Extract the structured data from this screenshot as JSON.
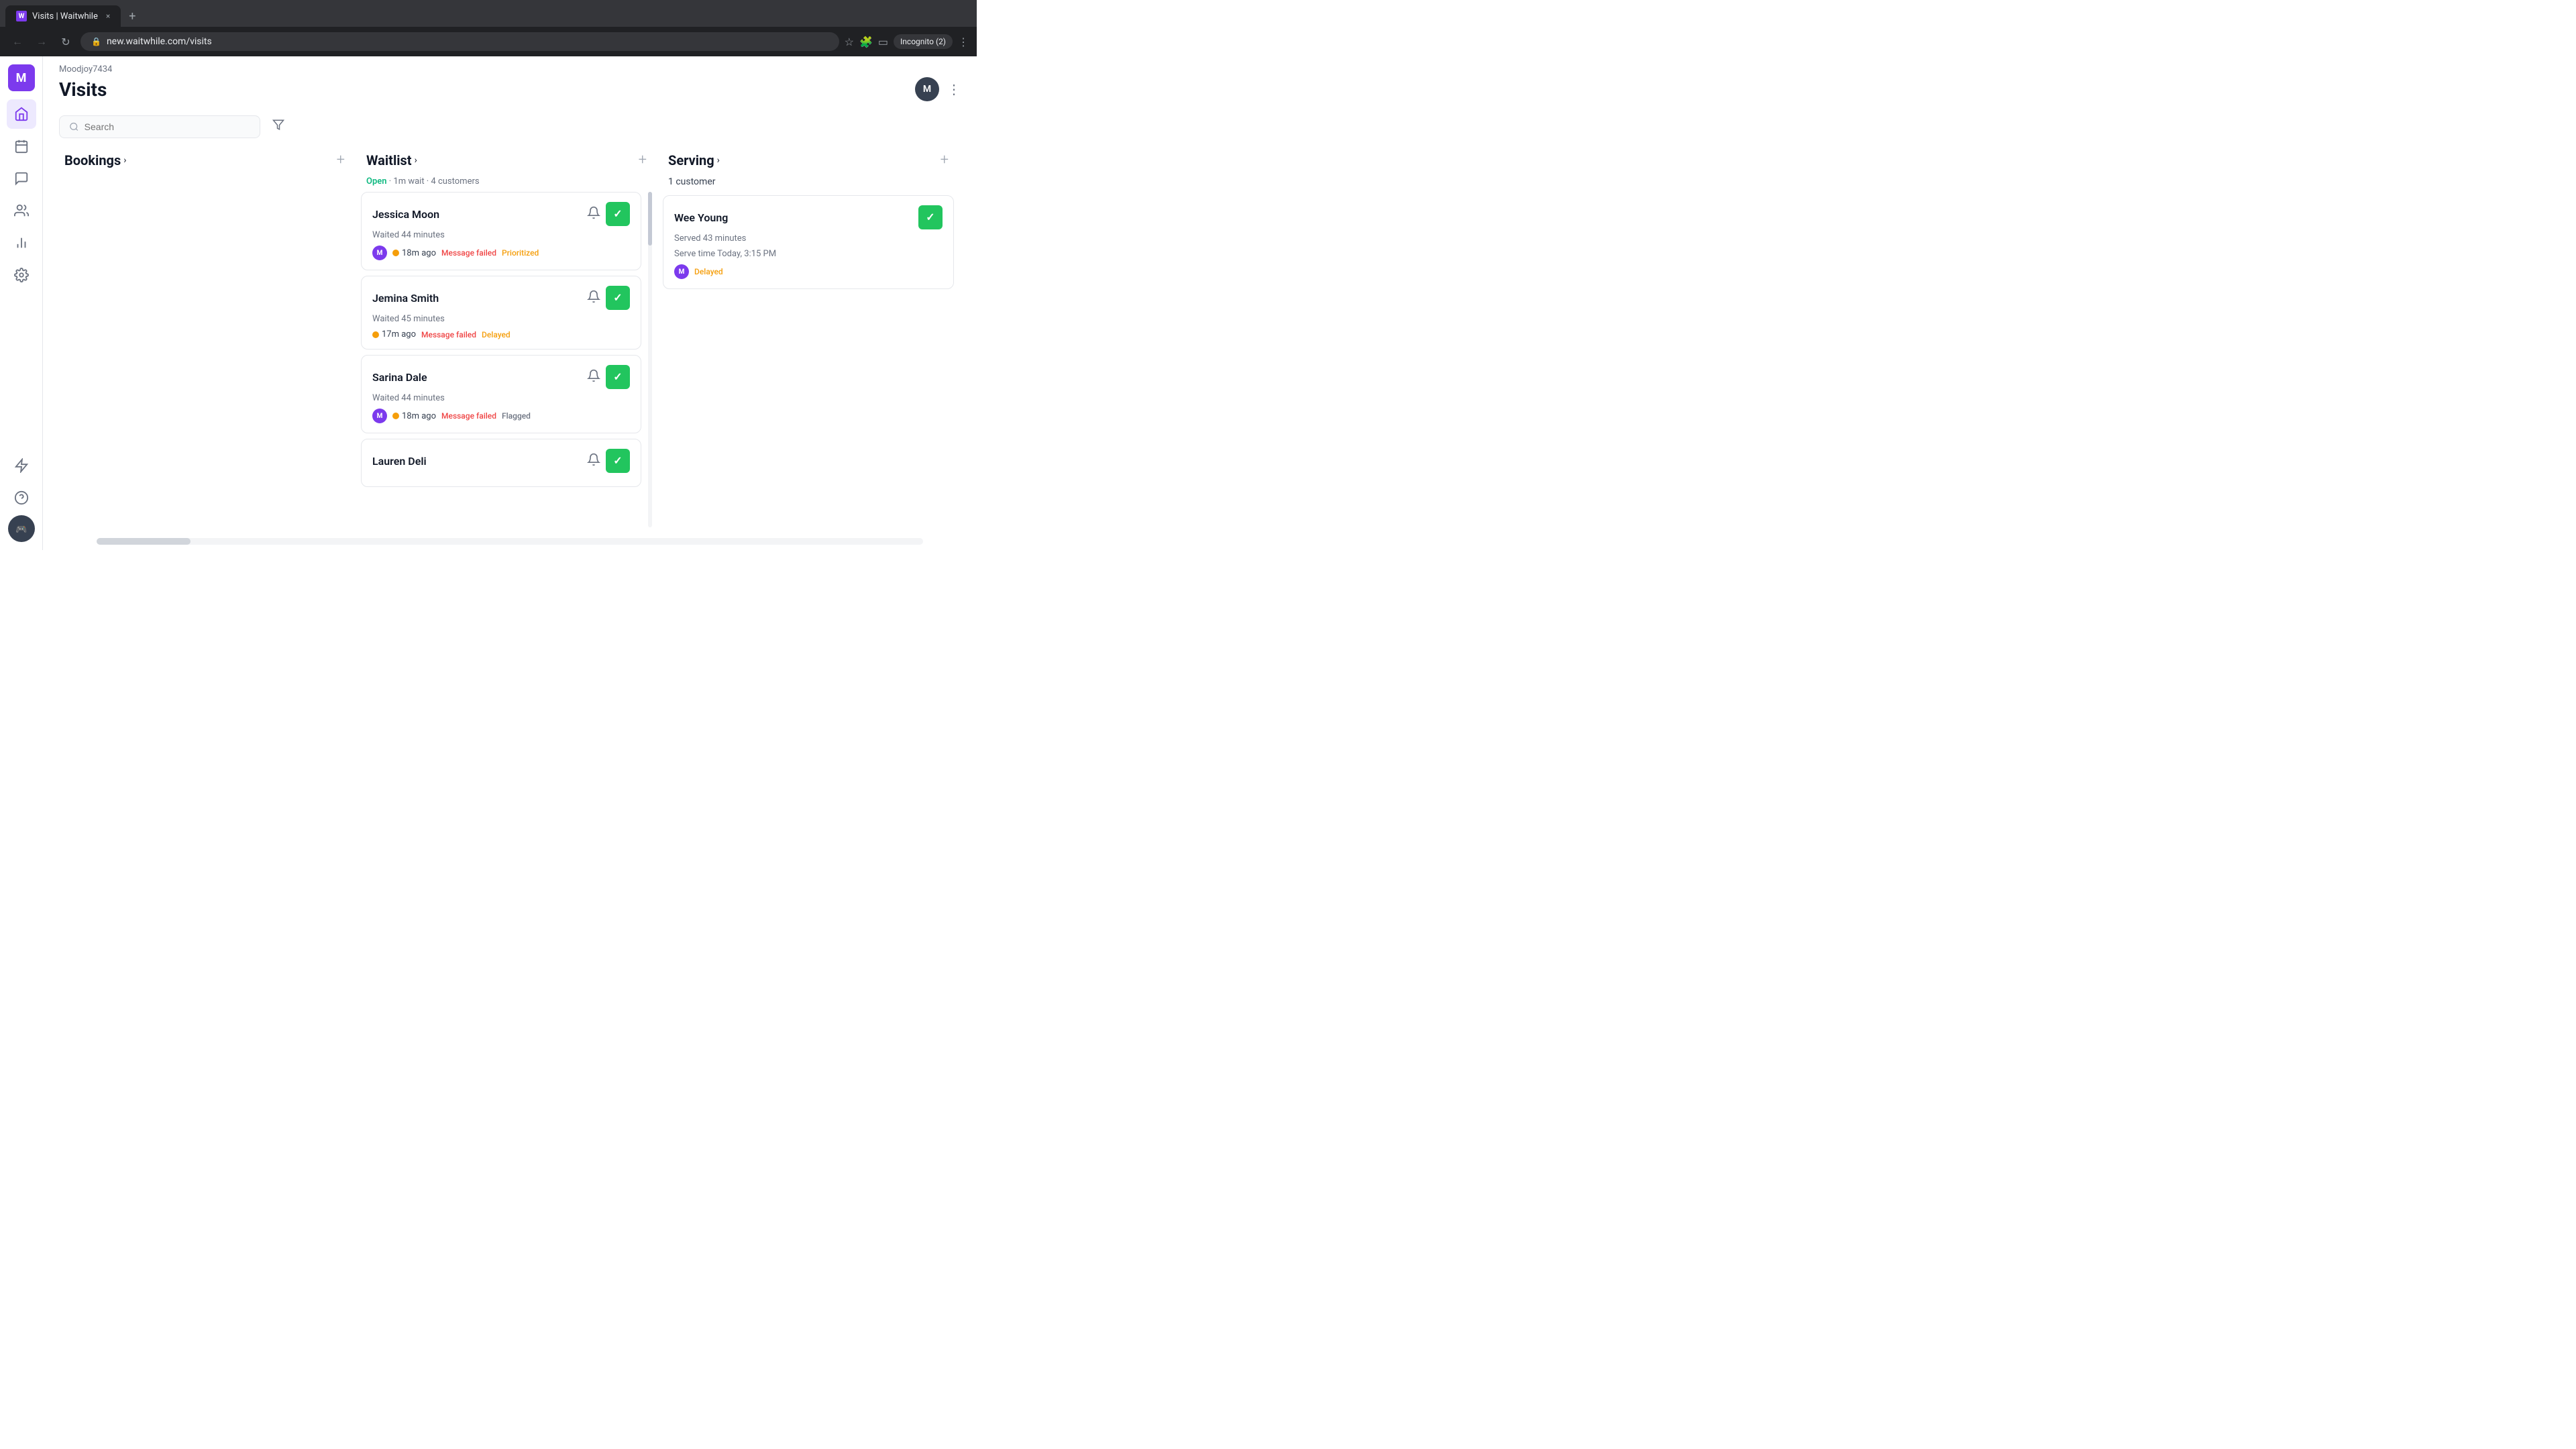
{
  "browser": {
    "tab_favicon": "W",
    "tab_title": "Visits | Waitwhile",
    "tab_close": "×",
    "new_tab": "+",
    "address": "new.waitwhile.com/visits",
    "incognito_label": "Incognito (2)"
  },
  "app": {
    "brand_initial": "M",
    "org_label": "Moodjoy7434",
    "page_title": "Visits",
    "user_initial": "M",
    "search_placeholder": "Search"
  },
  "sidebar": {
    "items": [
      {
        "name": "home",
        "icon": "⌂",
        "active": true
      },
      {
        "name": "calendar",
        "icon": "📅",
        "active": false
      },
      {
        "name": "chat",
        "icon": "💬",
        "active": false
      },
      {
        "name": "users",
        "icon": "👥",
        "active": false
      },
      {
        "name": "analytics",
        "icon": "📊",
        "active": false
      },
      {
        "name": "settings",
        "icon": "⚙",
        "active": false
      }
    ],
    "bottom": [
      {
        "name": "flash",
        "icon": "⚡"
      },
      {
        "name": "help",
        "icon": "?"
      }
    ]
  },
  "columns": {
    "bookings": {
      "title": "Bookings",
      "add_label": "+",
      "cards": []
    },
    "waitlist": {
      "title": "Waitlist",
      "add_label": "+",
      "status_open": "Open",
      "status_detail": "· 1m wait · 4 customers",
      "cards": [
        {
          "id": "jessica-moon",
          "name": "Jessica Moon",
          "wait": "Waited 44 minutes",
          "time": "18m ago",
          "message_status": "Message failed",
          "badge": "Prioritized"
        },
        {
          "id": "jemina-smith",
          "name": "Jemina Smith",
          "wait": "Waited 45 minutes",
          "time": "17m ago",
          "message_status": "Message failed",
          "badge": "Delayed"
        },
        {
          "id": "sarina-dale",
          "name": "Sarina Dale",
          "wait": "Waited 44 minutes",
          "time": "18m ago",
          "message_status": "Message failed",
          "badge": "Flagged"
        },
        {
          "id": "lauren-deli",
          "name": "Lauren Deli",
          "wait": "",
          "time": "",
          "message_status": "",
          "badge": "",
          "partial": true
        }
      ]
    },
    "serving": {
      "title": "Serving",
      "add_label": "+",
      "customer_count": "1 customer",
      "cards": [
        {
          "id": "wee-young",
          "name": "Wee Young",
          "served": "Served 43 minutes",
          "serve_time": "Serve time Today, 3:15 PM",
          "badge": "Delayed"
        }
      ]
    }
  }
}
